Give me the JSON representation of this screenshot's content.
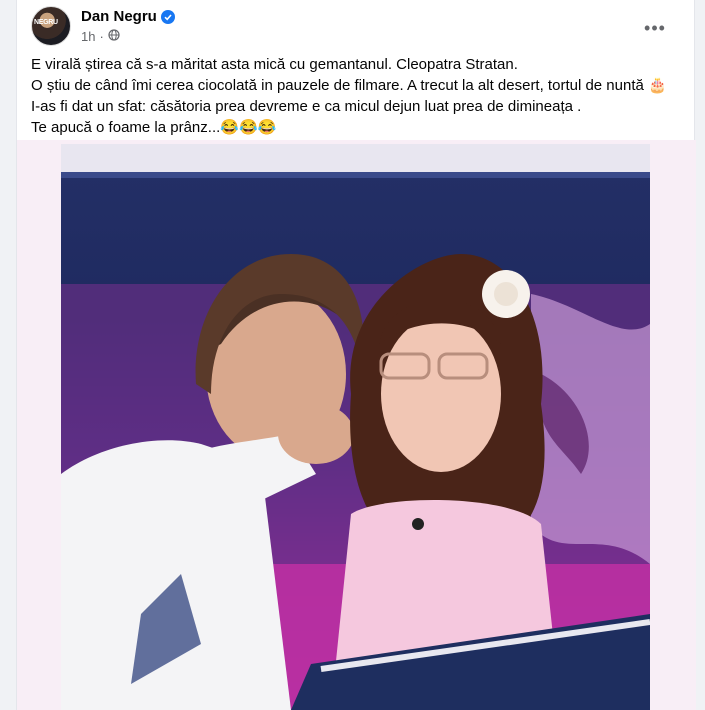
{
  "post": {
    "author": "Dan Negru",
    "avatar_tag": "NEGRU",
    "time": "1h",
    "more_label": "•••",
    "text_lines": [
      "E virală știrea că s-a măritat asta mică cu gemantanul. Cleopatra Stratan.",
      "O știu de când îmi cerea ciocolată in pauzele de filmare. A trecut la alt desert, tortul de nuntă 🎂",
      "I-as fi dat un sfat: căsătoria prea devreme e ca micul dejun luat prea de dimineața .",
      "Te apucă o foame la prânz...😂😂😂"
    ]
  },
  "icons": {
    "verified": "verified-badge-icon",
    "globe": "globe-icon",
    "more": "more-options-icon"
  },
  "colors": {
    "verified_blue": "#1877f2",
    "text": "#050505",
    "secondary": "#65676b"
  }
}
